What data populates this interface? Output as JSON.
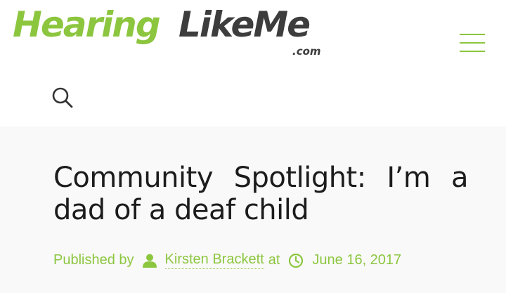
{
  "header": {
    "logo": {
      "part1": "Hearing",
      "part2": "LikeMe",
      "part3": ".com"
    },
    "menu_icon": "hamburger-icon",
    "search_icon": "search-icon"
  },
  "post": {
    "title": "Community Spotlight: I’m a dad of a deaf child",
    "published_by_label": "Published by",
    "author": "Kirsten Brackett",
    "at_label": "at",
    "date": "June 16, 2017"
  },
  "colors": {
    "brand_green": "#8cc63f",
    "logo_dark": "#3d3d3d",
    "content_bg": "#f9f9f9",
    "title_text": "#1c1c1c"
  }
}
